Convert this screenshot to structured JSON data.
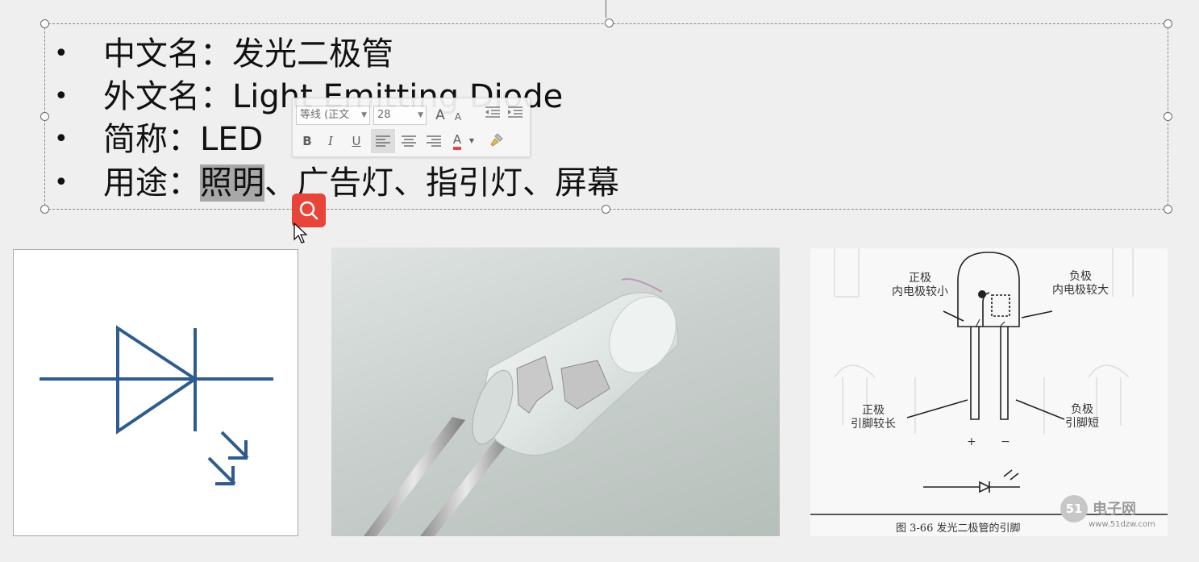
{
  "slide": {
    "bullets": [
      {
        "text": "中文名：发光二极管"
      },
      {
        "text": "外文名：Light Emitting Diode"
      },
      {
        "text": "简称：LED"
      },
      {
        "label": "用途：",
        "highlight": "照明",
        "rest": "、广告灯、指引灯、屏幕"
      }
    ],
    "bullet_char": "•"
  },
  "mini_toolbar": {
    "font_name": "等线 (正文",
    "font_size": "28",
    "bold_label": "B",
    "italic_label": "I",
    "underline_label": "U",
    "font_color_label": "A",
    "grow_font_label": "A",
    "shrink_font_label": "A",
    "icons": [
      "grow-font-icon",
      "shrink-font-icon",
      "decrease-indent-icon",
      "increase-indent-icon",
      "align-left-icon",
      "align-center-icon",
      "align-right-icon",
      "font-color-icon",
      "format-painter-icon"
    ]
  },
  "search_button": {
    "icon": "search-icon",
    "color": "#e8443a"
  },
  "images": {
    "symbol": {
      "icon": "led-symbol-icon",
      "color": "#2f5b8f"
    },
    "photo": {
      "icon": "led-photo"
    },
    "diagram": {
      "label_anode_top": "正极",
      "label_anode_top_2": "内电极较小",
      "label_cathode_top": "负极",
      "label_cathode_top_2": "内电极较大",
      "label_anode_bottom": "正极",
      "label_anode_bottom_2": "引脚较长",
      "label_cathode_bottom": "负极",
      "label_cathode_bottom_2": "引脚短",
      "plus": "+",
      "minus": "−",
      "caption": "图 3-66  发光二极管的引脚",
      "watermark_logo": "51",
      "watermark_text": "电子网",
      "watermark_url": "www.51dzw.com"
    }
  }
}
